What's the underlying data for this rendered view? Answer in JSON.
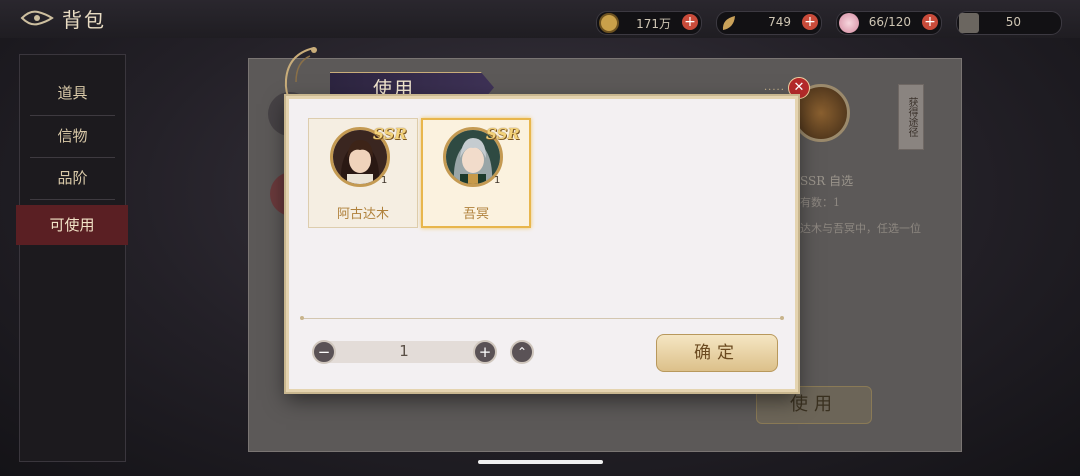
{
  "header": {
    "title": "背包",
    "resources": [
      {
        "icon": "coin-icon",
        "value": "171万",
        "has_plus": true
      },
      {
        "icon": "leaf-icon",
        "value": "749",
        "has_plus": true
      },
      {
        "icon": "flower-icon",
        "value": "66/120",
        "has_plus": true
      },
      {
        "icon": "scroll-icon",
        "value": "50",
        "has_plus": false
      }
    ]
  },
  "sidebar": {
    "items": [
      {
        "label": "道具",
        "active": false
      },
      {
        "label": "信物",
        "active": false
      },
      {
        "label": "品阶",
        "active": false
      },
      {
        "label": "可使用",
        "active": true
      }
    ]
  },
  "background": {
    "item_name": "SSR 自选",
    "own_count": "有数：1",
    "description": "达木与吾冥中，任选一位",
    "source_label": "获得途径",
    "use_label": "使用"
  },
  "modal": {
    "title": "使用",
    "characters": [
      {
        "name": "阿古达木",
        "rarity": "SSR",
        "count": "1",
        "selected": false
      },
      {
        "name": "吾冥",
        "rarity": "SSR",
        "count": "1",
        "selected": true
      }
    ],
    "quantity": "1",
    "confirm_label": "确定"
  },
  "colors": {
    "accent_gold": "#e8b64c",
    "name_gold": "#b0813b",
    "sidebar_active": "#5a1f23",
    "close_red": "#b42a2a"
  }
}
